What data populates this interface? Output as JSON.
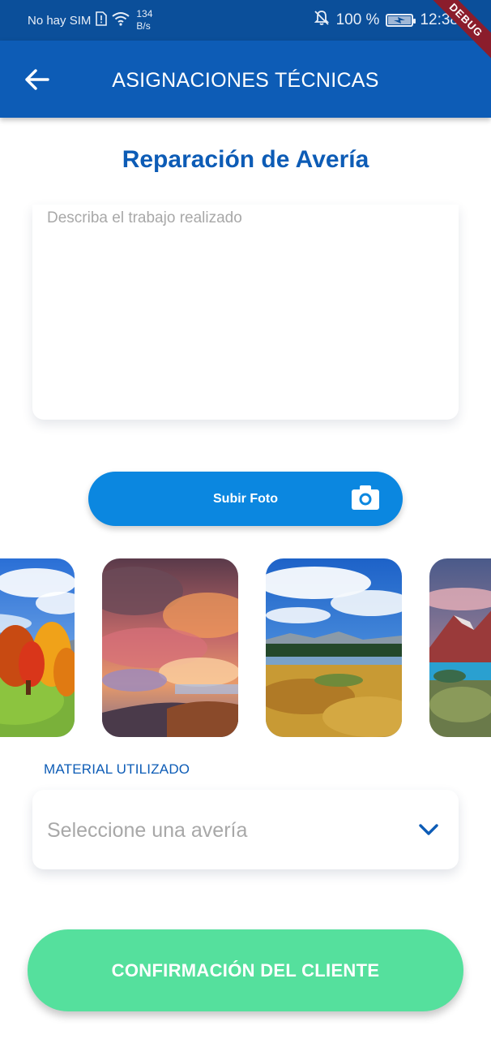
{
  "status_bar": {
    "carrier": "No hay SIM",
    "net_speed_value": "134",
    "net_speed_unit": "B/s",
    "battery_percent": "100 %",
    "time": "12:38",
    "battery_level": 1.0,
    "icons": [
      "sim-alert-icon",
      "wifi-icon",
      "bell-off-icon",
      "battery-charging-icon"
    ]
  },
  "debug_banner": "DEBUG",
  "app_bar": {
    "title": "ASIGNACIONES TÉCNICAS",
    "back_icon": "arrow-left-icon"
  },
  "section": {
    "title": "Reparación de Avería"
  },
  "description": {
    "value": "",
    "placeholder": "Describa el trabajo realizado"
  },
  "upload": {
    "label": "Subir Foto",
    "icon": "camera-icon"
  },
  "gallery": {
    "photos": [
      {
        "subject": "autumn trees meadow",
        "visible_fraction": 0.55
      },
      {
        "subject": "sunset clouds"
      },
      {
        "subject": "grassland with lake and forest"
      },
      {
        "subject": "mountain lake",
        "visible_fraction": 0.45
      }
    ]
  },
  "material": {
    "label": "MATERIAL UTILIZADO",
    "selected_value": "Seleccione una avería",
    "icon": "chevron-down-icon"
  },
  "confirm": {
    "label": "CONFIRMACIÓN DEL CLIENTE"
  },
  "colors": {
    "status_bar_bg": "#0b4f9a",
    "app_bar_bg": "#0d5cb6",
    "accent_blue": "#0b87e0",
    "confirm_green": "#55e09d",
    "debug_ribbon": "#8b1d2c",
    "placeholder_gray": "#a8a8a8"
  }
}
